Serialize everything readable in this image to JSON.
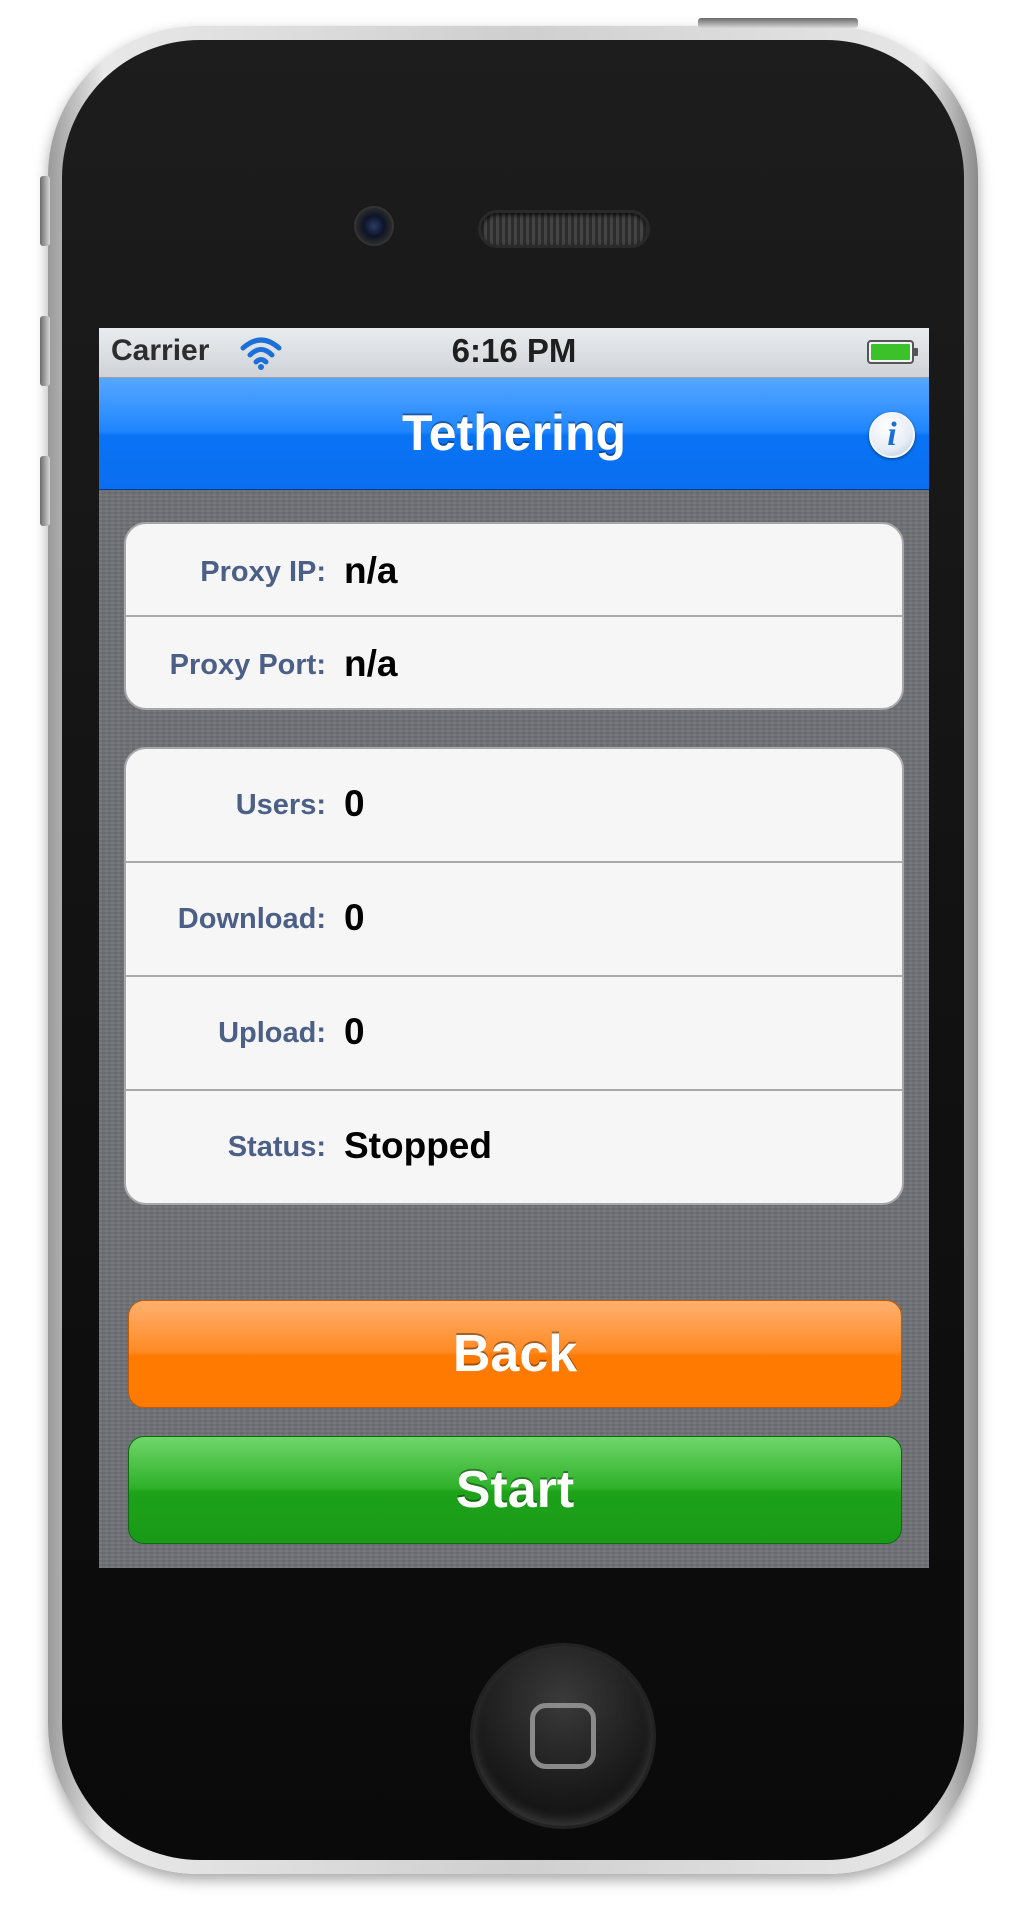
{
  "status_bar": {
    "carrier": "Carrier",
    "time": "6:16 PM"
  },
  "nav_bar": {
    "title": "Tethering",
    "info_icon": "info-icon"
  },
  "proxy_group": [
    {
      "label": "Proxy IP:",
      "value": "n/a"
    },
    {
      "label": "Proxy Port:",
      "value": "n/a"
    }
  ],
  "stats_group": [
    {
      "label": "Users:",
      "value": "0"
    },
    {
      "label": "Download:",
      "value": "0"
    },
    {
      "label": "Upload:",
      "value": "0"
    },
    {
      "label": "Status:",
      "value": "Stopped"
    }
  ],
  "buttons": {
    "back_label": "Back",
    "start_label": "Start"
  },
  "colors": {
    "nav_blue": "#1f86ff",
    "back_orange": "#ff7a00",
    "start_green": "#1da21a",
    "label_blue": "#4c5f86"
  }
}
